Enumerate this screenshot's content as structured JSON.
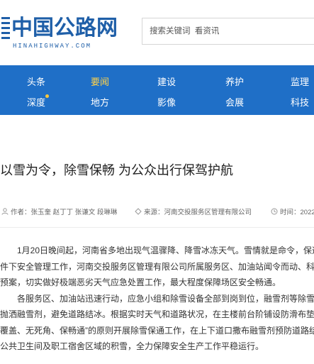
{
  "header": {
    "logo_cn": "中国公路网",
    "logo_en": "HINAHIGHWAY.COM",
    "search_placeholder": "搜索关键词  看资讯"
  },
  "nav": {
    "row1": [
      "头条",
      "要闻",
      "建设",
      "养护",
      "监理"
    ],
    "row2": [
      "深度",
      "地方",
      "影像",
      "会展",
      "科技"
    ],
    "active": "要闻"
  },
  "article": {
    "title": "以雪为令，除雪保畅 为公众出行保驾护航",
    "author": "作者：张玉奎 赵丁丁 张谦文 段琳琳",
    "source": "来源：河南交投服务区管理有限公司",
    "time": "时间：2022-",
    "paragraphs": [
      [
        "1月20日晚间起，河南省多地出现气温骤降、降雪冰冻天气。雪情就是命令，保通就",
        "件下安全管理工作，河南交投服务区管理有限公司所属服务区、加油站闻令而动、科学部",
        "预案，切实做好极端恶劣天气应急处置工作，最大程度保障场区安全畅通。"
      ],
      [
        "各服务区、加油站迅速行动，应急小组和除雪设备全部到岗到位，融雪剂等除雪物资",
        "抛洒融雪剂，避免道路结冰。根据实时天气和道路状况，在主楼前台阶铺设防滑布垫，",
        "覆盖、无死角、保畅通”的原则开展除雪保通工作，在上下道口撒布融雪剂预防道路结冰",
        "公共卫生间及职工宿舍区域的积雪，全力保障安全生产工作平稳运行。"
      ]
    ]
  },
  "colors": {
    "brand": "#1f5fa8",
    "nav_bg": "#1f6fc7",
    "nav_active": "#ffd24a",
    "nav_dot": "#ffc83a"
  },
  "icons": [
    "user-icon",
    "source-icon",
    "clock-icon"
  ]
}
